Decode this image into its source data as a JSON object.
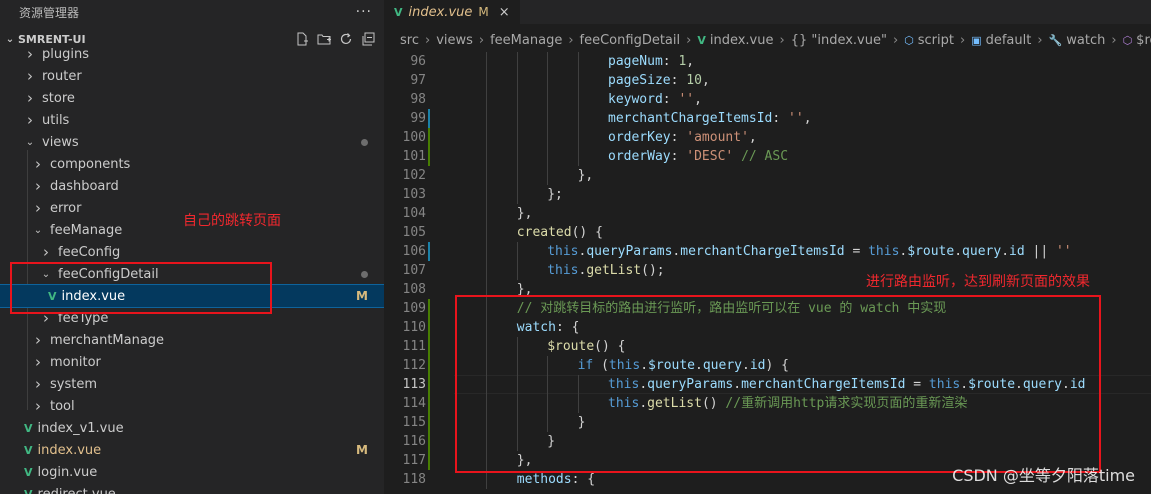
{
  "sidebar": {
    "title": "资源管理器",
    "more_icon": "more-icon",
    "project": "SMRENT-UI",
    "tree": [
      {
        "label": "plugins",
        "type": "folder",
        "open": false,
        "indent": 1,
        "partial": true
      },
      {
        "label": "router",
        "type": "folder",
        "open": false,
        "indent": 1
      },
      {
        "label": "store",
        "type": "folder",
        "open": false,
        "indent": 1
      },
      {
        "label": "utils",
        "type": "folder",
        "open": false,
        "indent": 1
      },
      {
        "label": "views",
        "type": "folder",
        "open": true,
        "indent": 1,
        "dot": true
      },
      {
        "label": "components",
        "type": "folder",
        "open": false,
        "indent": 2
      },
      {
        "label": "dashboard",
        "type": "folder",
        "open": false,
        "indent": 2
      },
      {
        "label": "error",
        "type": "folder",
        "open": false,
        "indent": 2
      },
      {
        "label": "feeManage",
        "type": "folder",
        "open": true,
        "indent": 2
      },
      {
        "label": "feeConfig",
        "type": "folder",
        "open": false,
        "indent": 3
      },
      {
        "label": "feeConfigDetail",
        "type": "folder",
        "open": true,
        "indent": 3,
        "dot": true
      },
      {
        "label": "index.vue",
        "type": "vue",
        "indent": 4,
        "badge": "M",
        "active": true
      },
      {
        "label": "feeType",
        "type": "folder",
        "open": false,
        "indent": 3
      },
      {
        "label": "merchantManage",
        "type": "folder",
        "open": false,
        "indent": 2
      },
      {
        "label": "monitor",
        "type": "folder",
        "open": false,
        "indent": 2
      },
      {
        "label": "system",
        "type": "folder",
        "open": false,
        "indent": 2
      },
      {
        "label": "tool",
        "type": "folder",
        "open": false,
        "indent": 2
      },
      {
        "label": "index_v1.vue",
        "type": "vue",
        "indent": 1
      },
      {
        "label": "index.vue",
        "type": "vue",
        "indent": 1,
        "badge": "M",
        "modified": true
      },
      {
        "label": "login.vue",
        "type": "vue",
        "indent": 1
      },
      {
        "label": "redirect.vue",
        "type": "vue",
        "indent": 1,
        "partial": true
      }
    ]
  },
  "tab": {
    "label": "index.vue",
    "badge": "M",
    "close": "×"
  },
  "breadcrumb": [
    "src",
    "views",
    "feeManage",
    "feeConfigDetail",
    "index.vue",
    "{} \"index.vue\"",
    "script",
    "default",
    "watch",
    "$route"
  ],
  "annotations": {
    "sidebar_note": "自己的跳转页面",
    "code_note": "进行路由监听，达到刷新页面的效果"
  },
  "watermark": "CSDN @坐等夕阳落time",
  "editor": {
    "current_line": 113,
    "lines": [
      {
        "n": 96,
        "indent": 20,
        "tokens": [
          [
            "p",
            "pageNum"
          ],
          [
            "d",
            ": "
          ],
          [
            "n",
            "1"
          ],
          [
            "d",
            ","
          ]
        ]
      },
      {
        "n": 97,
        "indent": 20,
        "tokens": [
          [
            "p",
            "pageSize"
          ],
          [
            "d",
            ": "
          ],
          [
            "n",
            "10"
          ],
          [
            "d",
            ","
          ]
        ]
      },
      {
        "n": 98,
        "indent": 20,
        "tokens": [
          [
            "p",
            "keyword"
          ],
          [
            "d",
            ": "
          ],
          [
            "s",
            "''"
          ],
          [
            "d",
            ","
          ]
        ]
      },
      {
        "n": 99,
        "indent": 20,
        "tokens": [
          [
            "p",
            "merchantChargeItemsId"
          ],
          [
            "d",
            ": "
          ],
          [
            "s",
            "''"
          ],
          [
            "d",
            ","
          ]
        ],
        "gutter": "mod"
      },
      {
        "n": 100,
        "indent": 20,
        "tokens": [
          [
            "p",
            "orderKey"
          ],
          [
            "d",
            ": "
          ],
          [
            "s",
            "'amount'"
          ],
          [
            "d",
            ","
          ]
        ],
        "gutter": "add"
      },
      {
        "n": 101,
        "indent": 20,
        "tokens": [
          [
            "p",
            "orderWay"
          ],
          [
            "d",
            ": "
          ],
          [
            "s",
            "'DESC'"
          ],
          [
            "d",
            " "
          ],
          [
            "c",
            "// ASC"
          ]
        ],
        "gutter": "add"
      },
      {
        "n": 102,
        "indent": 16,
        "tokens": [
          [
            "d",
            "},"
          ]
        ]
      },
      {
        "n": 103,
        "indent": 12,
        "tokens": [
          [
            "d",
            "};"
          ]
        ]
      },
      {
        "n": 104,
        "indent": 8,
        "tokens": [
          [
            "d",
            "},"
          ]
        ]
      },
      {
        "n": 105,
        "indent": 8,
        "tokens": [
          [
            "f",
            "created"
          ],
          [
            "d",
            "() {"
          ]
        ]
      },
      {
        "n": 106,
        "indent": 12,
        "tokens": [
          [
            "k",
            "this"
          ],
          [
            "d",
            "."
          ],
          [
            "p",
            "queryParams"
          ],
          [
            "d",
            "."
          ],
          [
            "p",
            "merchantChargeItemsId"
          ],
          [
            "d",
            " = "
          ],
          [
            "k",
            "this"
          ],
          [
            "d",
            "."
          ],
          [
            "p",
            "$route"
          ],
          [
            "d",
            "."
          ],
          [
            "p",
            "query"
          ],
          [
            "d",
            "."
          ],
          [
            "p",
            "id"
          ],
          [
            "d",
            " || "
          ],
          [
            "s",
            "''"
          ]
        ],
        "gutter": "mod"
      },
      {
        "n": 107,
        "indent": 12,
        "tokens": [
          [
            "k",
            "this"
          ],
          [
            "d",
            "."
          ],
          [
            "f",
            "getList"
          ],
          [
            "d",
            "();"
          ]
        ]
      },
      {
        "n": 108,
        "indent": 8,
        "tokens": [
          [
            "d",
            "},"
          ]
        ]
      },
      {
        "n": 109,
        "indent": 8,
        "tokens": [
          [
            "c",
            "// 对跳转目标的路由进行监听，路由监听可以在 vue 的 watch 中实现"
          ]
        ],
        "gutter": "add"
      },
      {
        "n": 110,
        "indent": 8,
        "tokens": [
          [
            "p",
            "watch"
          ],
          [
            "d",
            ": {"
          ]
        ],
        "gutter": "add"
      },
      {
        "n": 111,
        "indent": 12,
        "tokens": [
          [
            "f",
            "$route"
          ],
          [
            "d",
            "() {"
          ]
        ],
        "gutter": "add"
      },
      {
        "n": 112,
        "indent": 16,
        "tokens": [
          [
            "k",
            "if"
          ],
          [
            "d",
            " ("
          ],
          [
            "k",
            "this"
          ],
          [
            "d",
            "."
          ],
          [
            "p",
            "$route"
          ],
          [
            "d",
            "."
          ],
          [
            "p",
            "query"
          ],
          [
            "d",
            "."
          ],
          [
            "p",
            "id"
          ],
          [
            "d",
            ") {"
          ]
        ],
        "gutter": "add"
      },
      {
        "n": 113,
        "indent": 20,
        "tokens": [
          [
            "k",
            "this"
          ],
          [
            "d",
            "."
          ],
          [
            "p",
            "queryParams"
          ],
          [
            "d",
            "."
          ],
          [
            "p",
            "merchantChargeItemsId"
          ],
          [
            "d",
            " = "
          ],
          [
            "k",
            "this"
          ],
          [
            "d",
            "."
          ],
          [
            "p",
            "$route"
          ],
          [
            "d",
            "."
          ],
          [
            "p",
            "query"
          ],
          [
            "d",
            "."
          ],
          [
            "p",
            "id"
          ]
        ],
        "gutter": "add"
      },
      {
        "n": 114,
        "indent": 20,
        "tokens": [
          [
            "k",
            "this"
          ],
          [
            "d",
            "."
          ],
          [
            "f",
            "getList"
          ],
          [
            "d",
            "() "
          ],
          [
            "c",
            "//重新调用http请求实现页面的重新渲染"
          ]
        ],
        "gutter": "add"
      },
      {
        "n": 115,
        "indent": 16,
        "tokens": [
          [
            "d",
            "}"
          ]
        ],
        "gutter": "add"
      },
      {
        "n": 116,
        "indent": 12,
        "tokens": [
          [
            "d",
            "}"
          ]
        ],
        "gutter": "add"
      },
      {
        "n": 117,
        "indent": 8,
        "tokens": [
          [
            "d",
            "},"
          ]
        ],
        "gutter": "add"
      },
      {
        "n": 118,
        "indent": 8,
        "tokens": [
          [
            "p",
            "methods"
          ],
          [
            "d",
            ": {"
          ]
        ]
      }
    ]
  }
}
